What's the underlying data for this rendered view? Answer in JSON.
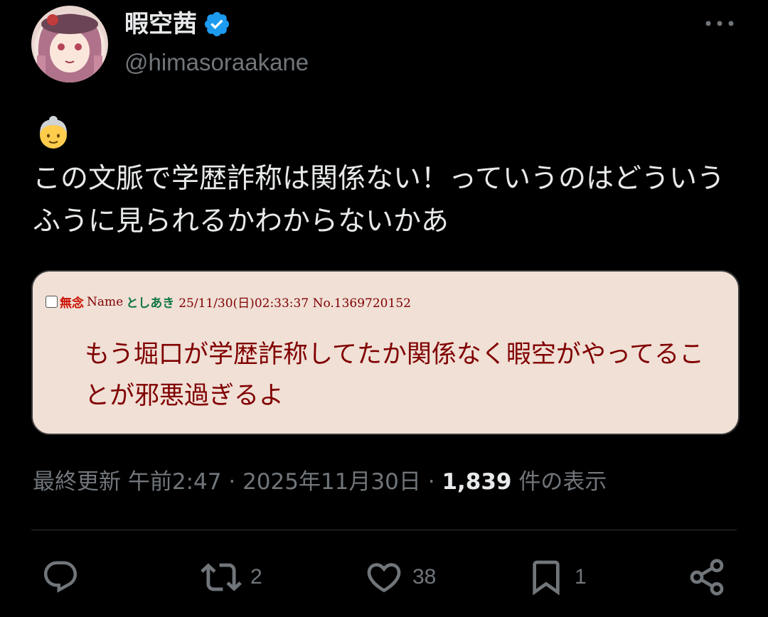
{
  "user": {
    "display_name": "暇空茜",
    "handle": "@himasoraakane",
    "avatar_icon": "avatar-image",
    "verified_icon": "verified-badge-icon",
    "verified_color": "#1d9bf0"
  },
  "post": {
    "emoji_icon": "older-woman-emoji",
    "text": "この文脈で学歴詐称は関係ない！っていうのはどういうふうに見られるかわからないかあ"
  },
  "quote_image": {
    "subject": "無念",
    "name_label": "Name",
    "name": "としあき",
    "datetime": "25/11/30(日)02:33:37 No.1369720152",
    "body": "もう堀口が学歴詐称してたか関係なく暇空がやってることが邪悪過ぎるよ"
  },
  "meta": {
    "updated_label": "最終更新",
    "time": "午前2:47",
    "separator": "·",
    "date": "2025年11月30日",
    "views_count": "1,839",
    "views_label": "件の表示"
  },
  "actions": {
    "reply_icon": "reply-icon",
    "retweet_icon": "retweet-icon",
    "retweet_count": "2",
    "like_icon": "heart-icon",
    "like_count": "38",
    "bookmark_icon": "bookmark-icon",
    "bookmark_count": "1",
    "share_icon": "share-icon"
  },
  "colors": {
    "background": "#000000",
    "text_primary": "#e7e9ea",
    "text_secondary": "#71767b",
    "divider": "#2f3336",
    "futaba_bg": "#f0e0d6",
    "futaba_text": "#800000",
    "futaba_subject": "#cc1105",
    "futaba_name": "#117743"
  }
}
